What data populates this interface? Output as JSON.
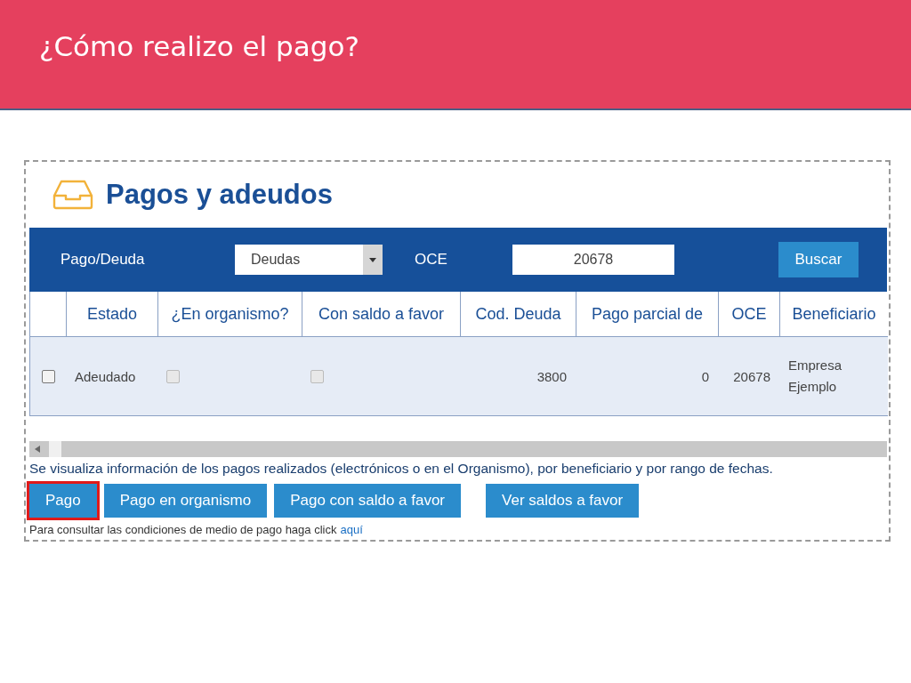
{
  "slide": {
    "title": "¿Cómo realizo el pago?"
  },
  "panel": {
    "title": "Pagos y adeudos"
  },
  "filters": {
    "type_label": "Pago/Deuda",
    "type_value": "Deudas",
    "oce_label": "OCE",
    "oce_value": "20678",
    "search_button": "Buscar"
  },
  "table": {
    "columns": [
      "Estado",
      "¿En organismo?",
      "Con saldo a favor",
      "Cod. Deuda",
      "Pago parcial de",
      "OCE",
      "Beneficiario"
    ],
    "rows": [
      {
        "checked": false,
        "cells": [
          {
            "kind": "text",
            "text": "Adeudado"
          },
          {
            "kind": "checkbox",
            "checked": false,
            "disabled": true
          },
          {
            "kind": "checkbox",
            "checked": false,
            "disabled": true
          },
          {
            "kind": "number",
            "text": "3800"
          },
          {
            "kind": "number",
            "text": "0"
          },
          {
            "kind": "number",
            "text": "20678"
          },
          {
            "kind": "text",
            "text": "Empresa Ejemplo"
          }
        ]
      }
    ]
  },
  "description": "Se visualiza información de los pagos realizados (electrónicos o en el Organismo), por beneficiario y por rango de fechas.",
  "buttons": [
    {
      "label": "Pago",
      "highlighted": true
    },
    {
      "label": "Pago en organismo",
      "highlighted": false
    },
    {
      "label": "Pago con saldo a favor",
      "highlighted": false
    },
    {
      "label": "Ver saldos a favor",
      "highlighted": false
    }
  ],
  "note": {
    "text": "Para consultar las condiciones de medio de pago haga click",
    "link": "aquí"
  }
}
